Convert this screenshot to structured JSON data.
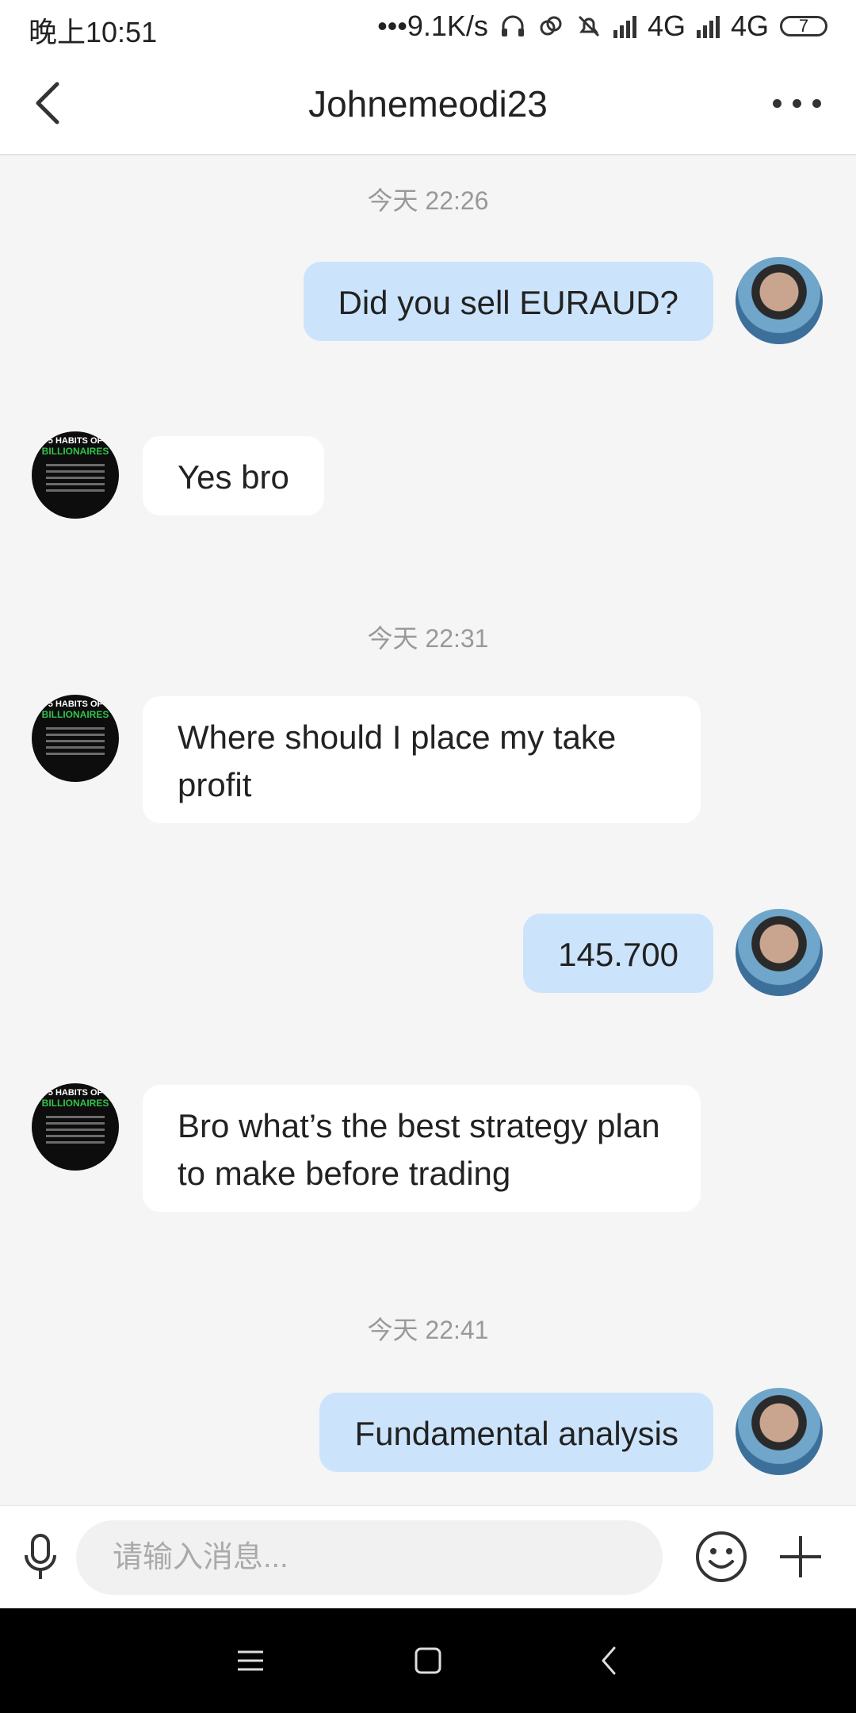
{
  "status_bar": {
    "time": "晚上10:51",
    "network_speed": "•••9.1K/s",
    "sim1": "4G",
    "sim2": "4G",
    "battery": "7",
    "icons": [
      "headphones-icon",
      "link-icon",
      "mute-icon",
      "signal-icon",
      "battery-icon"
    ]
  },
  "header": {
    "title": "Johnemeodi23",
    "back_icon": "chevron-left-icon",
    "more_icon": "more-dots-icon"
  },
  "chat": {
    "messages": [
      {
        "type": "timestamp",
        "text": "今天 22:26"
      },
      {
        "type": "sent",
        "text": "Did you sell EURAUD?"
      },
      {
        "type": "received",
        "text": "Yes bro"
      },
      {
        "type": "timestamp",
        "text": "今天 22:31"
      },
      {
        "type": "received",
        "text": "Where should I place my take profit"
      },
      {
        "type": "sent",
        "text": "145.700"
      },
      {
        "type": "received",
        "text": "Bro what’s the best strategy plan to make before trading"
      },
      {
        "type": "timestamp",
        "text": "今天 22:41"
      },
      {
        "type": "sent",
        "text": "Fundamental analysis"
      }
    ],
    "friend_avatar_text": [
      "5 HABITS OF",
      "BILLIONAIRES"
    ]
  },
  "input_bar": {
    "placeholder": "请输入消息...",
    "value": "",
    "icons": [
      "microphone-icon",
      "emoji-icon",
      "plus-icon"
    ]
  },
  "nav_bar": {
    "icons": [
      "menu-icon",
      "home-icon",
      "back-icon"
    ]
  },
  "colors": {
    "sent_bubble": "#cce4fb",
    "received_bubble": "#ffffff",
    "chat_background": "#f5f5f5",
    "nav_background": "#000000"
  }
}
